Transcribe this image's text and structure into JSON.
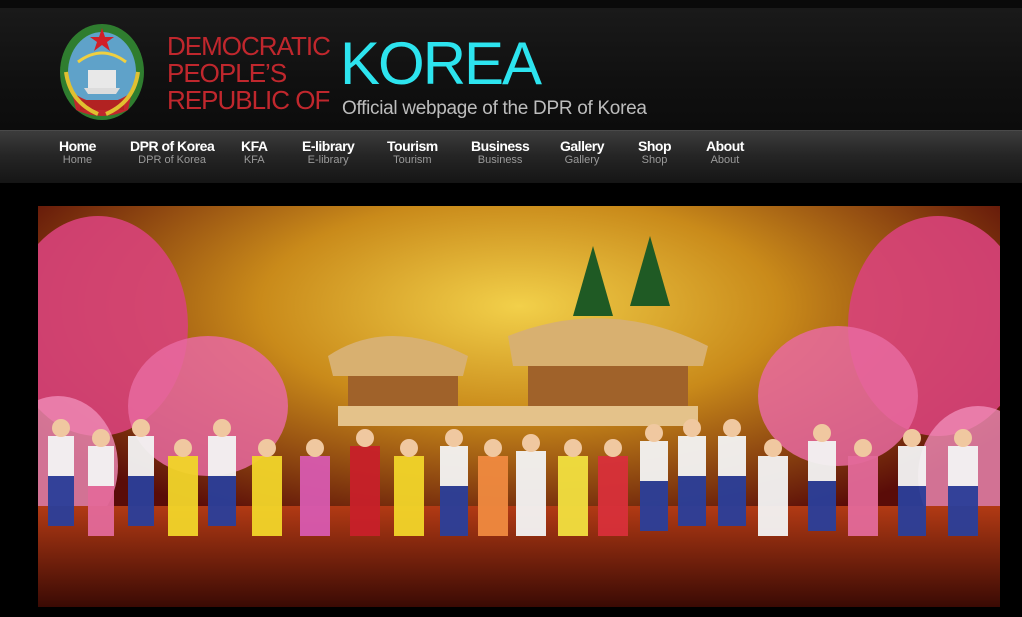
{
  "header": {
    "title_line1": "DEMOCRATIC",
    "title_line2": "PEOPLE’S",
    "title_line3": "REPUBLIC OF",
    "title_big": "KOREA",
    "tagline": "Official webpage of the DPR of Korea"
  },
  "nav": {
    "items": [
      {
        "label": "Home",
        "sub": "Home"
      },
      {
        "label": "DPR of Korea",
        "sub": "DPR of Korea"
      },
      {
        "label": "KFA",
        "sub": "KFA"
      },
      {
        "label": "E-library",
        "sub": "E-library"
      },
      {
        "label": "Tourism",
        "sub": "Tourism"
      },
      {
        "label": "Business",
        "sub": "Business"
      },
      {
        "label": "Gallery",
        "sub": "Gallery"
      },
      {
        "label": "Shop",
        "sub": "Shop"
      },
      {
        "label": "About",
        "sub": "About"
      }
    ]
  },
  "colors": {
    "title_red": "#c0272d",
    "title_cyan": "#2de4ef",
    "nav_text": "#ffffff",
    "nav_sub": "#9a9a9a"
  },
  "icons": {
    "emblem": "national-emblem-icon"
  }
}
